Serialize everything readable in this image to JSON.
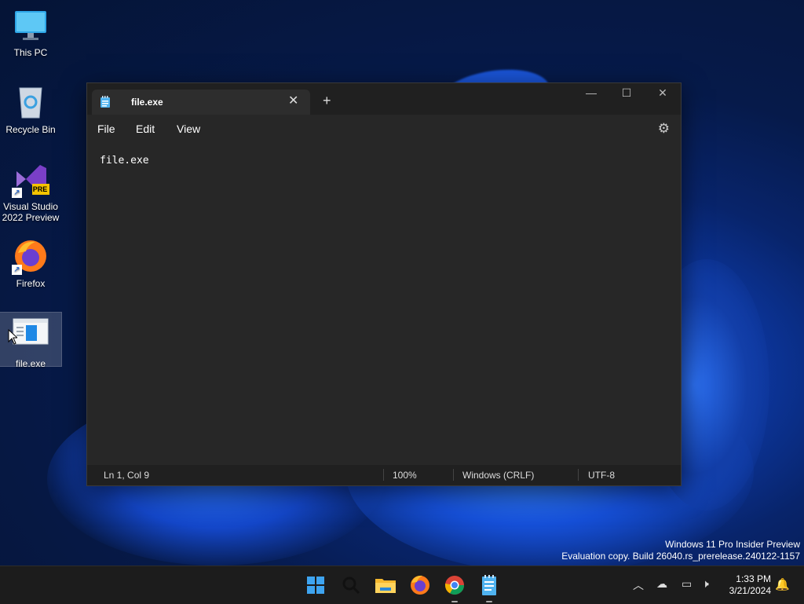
{
  "desktop": {
    "icons": [
      {
        "label": "This PC",
        "icon": "monitor-icon"
      },
      {
        "label": "Recycle Bin",
        "icon": "recycle-bin-icon"
      },
      {
        "label": "Visual Studio 2022 Preview",
        "icon": "visual-studio-icon",
        "badge": "PRE"
      },
      {
        "label": "Firefox",
        "icon": "firefox-icon"
      },
      {
        "label": "file.exe",
        "icon": "app-window-icon"
      }
    ]
  },
  "notepad": {
    "tab_title": "file.exe",
    "menu": [
      "File",
      "Edit",
      "View"
    ],
    "content": "file.exe",
    "status": {
      "position": "Ln 1, Col 9",
      "zoom": "100%",
      "line_ending": "Windows (CRLF)",
      "encoding": "UTF-8"
    }
  },
  "watermark": {
    "line1": "Windows 11 Pro Insider Preview",
    "line2": "Evaluation copy. Build 26040.rs_prerelease.240122-1157"
  },
  "taskbar": {
    "apps": [
      "start-icon",
      "search-icon",
      "file-explorer-icon",
      "firefox-icon",
      "chrome-icon",
      "notepad-icon"
    ],
    "time": "1:33 PM",
    "date": "3/21/2024"
  },
  "colors": {
    "window_bg": "#272727",
    "titlebar_bg": "#202020",
    "taskbar_bg": "#1c1c1c",
    "accent": "#0078d4"
  }
}
